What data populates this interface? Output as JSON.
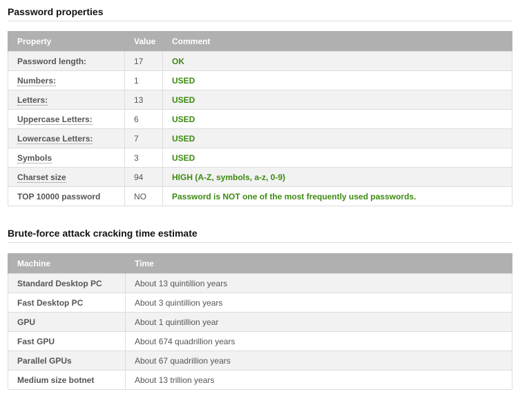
{
  "password_section": {
    "title": "Password properties",
    "headers": {
      "property": "Property",
      "value": "Value",
      "comment": "Comment"
    },
    "rows": [
      {
        "property": "Password length:",
        "value": "17",
        "comment": "OK",
        "dotted": false
      },
      {
        "property": "Numbers:",
        "value": "1",
        "comment": "USED",
        "dotted": true
      },
      {
        "property": "Letters:",
        "value": "13",
        "comment": "USED",
        "dotted": true
      },
      {
        "property": "Uppercase Letters:",
        "value": "6",
        "comment": "USED",
        "dotted": true
      },
      {
        "property": "Lowercase Letters:",
        "value": "7",
        "comment": "USED",
        "dotted": true
      },
      {
        "property": "Symbols",
        "value": "3",
        "comment": "USED",
        "dotted": true
      },
      {
        "property": "Charset size",
        "value": "94",
        "comment": "HIGH (A-Z, symbols, a-z, 0-9)",
        "dotted": true
      },
      {
        "property": "TOP 10000 password",
        "value": "NO",
        "comment": "Password is NOT one of the most frequently used passwords.",
        "dotted": false
      }
    ]
  },
  "bruteforce_section": {
    "title": "Brute-force attack cracking time estimate",
    "headers": {
      "machine": "Machine",
      "time": "Time"
    },
    "rows": [
      {
        "machine": "Standard Desktop PC",
        "time": "About 13 quintillion years"
      },
      {
        "machine": "Fast Desktop PC",
        "time": "About 3 quintillion years"
      },
      {
        "machine": "GPU",
        "time": "About 1 quintillion year"
      },
      {
        "machine": "Fast GPU",
        "time": "About 674 quadrillion years"
      },
      {
        "machine": "Parallel GPUs",
        "time": "About 67 quadrillion years"
      },
      {
        "machine": "Medium size botnet",
        "time": "About 13 trillion years"
      }
    ]
  },
  "colors": {
    "header_bg": "#b0b0b0",
    "row_alt_bg": "#f2f2f2",
    "comment_green": "#3b8a10",
    "border": "#dddddd"
  }
}
